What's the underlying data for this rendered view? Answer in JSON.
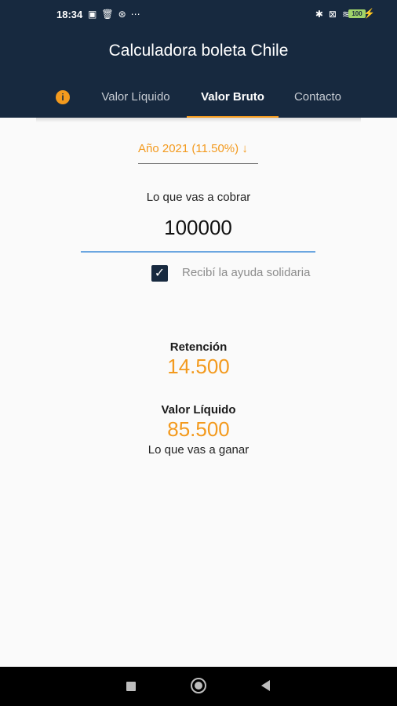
{
  "status_bar": {
    "time": "18:34",
    "battery": "100"
  },
  "app": {
    "title": "Calculadora boleta Chile"
  },
  "tabs": [
    {
      "label": "Valor Líquido"
    },
    {
      "label": "Valor Bruto"
    },
    {
      "label": "Contacto"
    }
  ],
  "form": {
    "year_select": "Año 2021 (11.50%)",
    "year_arrow": "↓",
    "cobrar_label": "Lo que vas a cobrar",
    "amount_value": "100000",
    "checkbox_label": "Recibí la ayuda solidaria",
    "checkbox_checked": true
  },
  "results": {
    "retencion_label": "Retención",
    "retencion_value": "14.500",
    "liquido_label": "Valor Líquido",
    "liquido_value": "85.500",
    "liquido_sub": "Lo que vas a ganar"
  },
  "colors": {
    "primary": "#17293f",
    "accent": "#f39a1e",
    "input_underline": "#6ba6e0"
  }
}
